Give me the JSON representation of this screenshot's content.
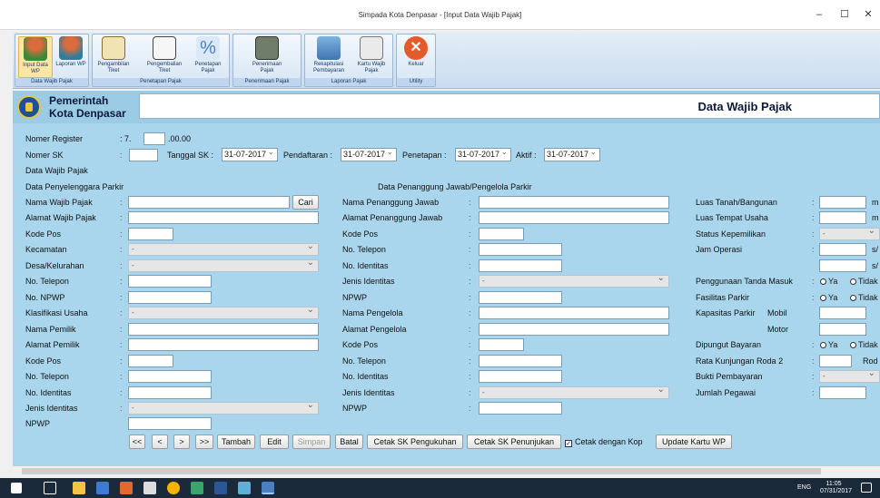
{
  "window": {
    "title": "Simpada Kota Denpasar - [Input Data Wajib Pajak]",
    "minimize": "–",
    "maximize": "☐",
    "close": "✕"
  },
  "ribbon": {
    "groups": [
      {
        "label": "Data Wajib Pajak",
        "buttons": [
          "Input Data WP",
          "Laporan WP"
        ]
      },
      {
        "label": "Penetapan Pajak",
        "buttons": [
          "Pengambilan Tiket",
          "Pengembalian Tiket",
          "Penetapan Pajak"
        ]
      },
      {
        "label": "Penerimaan Pajak",
        "buttons": [
          "Penerimaan Pajak"
        ]
      },
      {
        "label": "Laporan Pajak",
        "buttons": [
          "Rekapitulasi Pembayaran",
          "Kartu Wajib Pajak"
        ]
      },
      {
        "label": "Utility",
        "buttons": [
          "Keluar"
        ]
      }
    ]
  },
  "header": {
    "org_line1": "Pemerintah",
    "org_line2": "Kota Denpasar",
    "form_title": "Data Wajib  Pajak"
  },
  "top": {
    "nomer_register_label": "Nomer Register",
    "reg_prefix": "7.",
    "reg_suffix": ".00.00",
    "nomer_sk_label": "Nomer SK",
    "tanggal_sk_label": "Tanggal SK :",
    "tanggal_sk": "31-07-2017",
    "pendaftaran_label": "Pendaftaran :",
    "pendaftaran": "31-07-2017",
    "penetapan_label": "Penetapan :",
    "penetapan": "31-07-2017",
    "aktif_label": "Aktif :",
    "aktif": "31-07-2017",
    "data_wp_label": "Data Wajib Pajak"
  },
  "left": {
    "section": "Data Penyelenggara Parkir",
    "cari": "Cari",
    "fields": [
      "Nama Wajib Pajak",
      "Alamat Wajib Pajak",
      "Kode Pos",
      "Kecamatan",
      "Desa/Kelurahan",
      "No. Telepon",
      "No. NPWP",
      "Klasifikasi Usaha",
      "Nama Pemilik",
      "Alamat Pemilik",
      "Kode Pos",
      "No. Telepon",
      "No. Identitas",
      "Jenis Identitas",
      "NPWP"
    ],
    "dropdown_value": "-"
  },
  "middle": {
    "section": "Data Penanggung Jawab/Pengelola Parkir",
    "fields": [
      "Nama Penanggung Jawab",
      "Alamat Penanggung Jawab",
      "Kode Pos",
      "No. Telepon",
      "No. Identitas",
      "Jenis Identitas",
      "NPWP",
      "Nama Pengelola",
      "Alamat Pengelola",
      "Kode Pos",
      "No. Telepon",
      "No. Identitas",
      "Jenis Identitas",
      "NPWP"
    ],
    "dropdown_value": "-"
  },
  "right": {
    "luas_tanah": "Luas Tanah/Bangunan",
    "luas_tempat": "Luas Tempat Usaha",
    "status": "Status Kepemilikan",
    "jam": "Jam Operasi",
    "tanda_masuk": "Penggunaan Tanda Masuk",
    "fasilitas": "Fasilitas Parkir",
    "kapasitas": "Kapasitas Parkir",
    "mobil": "Mobil",
    "motor": "Motor",
    "dipungut": "Dipungut Bayaran",
    "rata": "Rata Kunjungan Roda 2",
    "rod": "Rod",
    "bukti": "Bukti Pembayaran",
    "jumlah": "Jumlah Pegawai",
    "unit_m": "m",
    "unit_s": "s/",
    "ya": "Ya",
    "tidak": "Tidak",
    "dash": "-"
  },
  "buttons": {
    "first": "<<",
    "prev": "<",
    "next": ">",
    "last": ">>",
    "tambah": "Tambah",
    "edit": "Edit",
    "simpan": "Simpan",
    "batal": "Batal",
    "cetak_pengukuhan": "Cetak SK Pengukuhan",
    "cetak_penunjukan": "Cetak SK Penunjukan",
    "cetak_kop": "Cetak dengan Kop",
    "update_kartu": "Update Kartu WP"
  },
  "taskbar": {
    "lang": "ENG",
    "time": "11:05",
    "date": "07/31/2017"
  },
  "colors": {
    "form_bg": "#a9d6ec",
    "header_bg": "#9ccbe5",
    "taskbar": "#1b2a3a"
  }
}
